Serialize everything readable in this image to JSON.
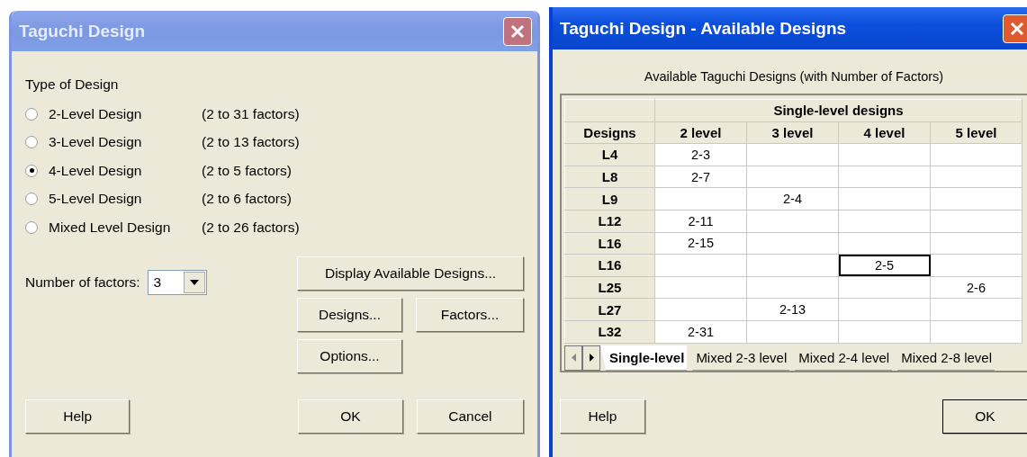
{
  "main_dialog": {
    "title": "Taguchi Design",
    "type_label": "Type of Design",
    "design_types": [
      {
        "label": "2-Level Design",
        "range": "(2 to 31 factors)",
        "selected": false
      },
      {
        "label": "3-Level Design",
        "range": "(2 to 13 factors)",
        "selected": false
      },
      {
        "label": "4-Level Design",
        "range": "(2 to 5 factors)",
        "selected": true
      },
      {
        "label": "5-Level Design",
        "range": "(2 to 6 factors)",
        "selected": false
      },
      {
        "label": "Mixed Level Design",
        "range": "(2 to 26 factors)",
        "selected": false
      }
    ],
    "factors_label": "Number of factors:",
    "factors_value": "3",
    "buttons": {
      "display": "Display Available Designs...",
      "designs": "Designs...",
      "factors": "Factors...",
      "options": "Options...",
      "help": "Help",
      "ok": "OK",
      "cancel": "Cancel"
    }
  },
  "designs_dialog": {
    "title": "Taguchi Design - Available Designs",
    "caption": "Available Taguchi Designs (with Number of Factors)",
    "table": {
      "row_header": "Designs",
      "group_header": "Single-level designs",
      "columns": [
        "2 level",
        "3 level",
        "4 level",
        "5 level"
      ],
      "rows": [
        {
          "design": "L4",
          "level_2": "2-3",
          "selected": false
        },
        {
          "design": "L8",
          "level_2": "2-7",
          "selected": false
        },
        {
          "design": "L9",
          "level_3": "2-4",
          "selected": false
        },
        {
          "design": "L12",
          "level_2": "2-11",
          "selected": false
        },
        {
          "design": "L16",
          "level_2": "2-15",
          "selected": false
        },
        {
          "design": "L16",
          "level_4": "2-5",
          "selected": true
        },
        {
          "design": "L25",
          "level_5": "2-6",
          "selected": false
        },
        {
          "design": "L27",
          "level_3": "2-13",
          "selected": false
        },
        {
          "design": "L32",
          "level_2": "2-31",
          "selected": false
        }
      ]
    },
    "sheet_tabs": [
      {
        "label": "Single-level",
        "selected": true
      },
      {
        "label": "Mixed 2-3 level",
        "selected": false
      },
      {
        "label": "Mixed 2-4 level",
        "selected": false
      },
      {
        "label": "Mixed 2-8 level",
        "selected": false
      }
    ],
    "buttons": {
      "help": "Help",
      "ok": "OK"
    }
  }
}
